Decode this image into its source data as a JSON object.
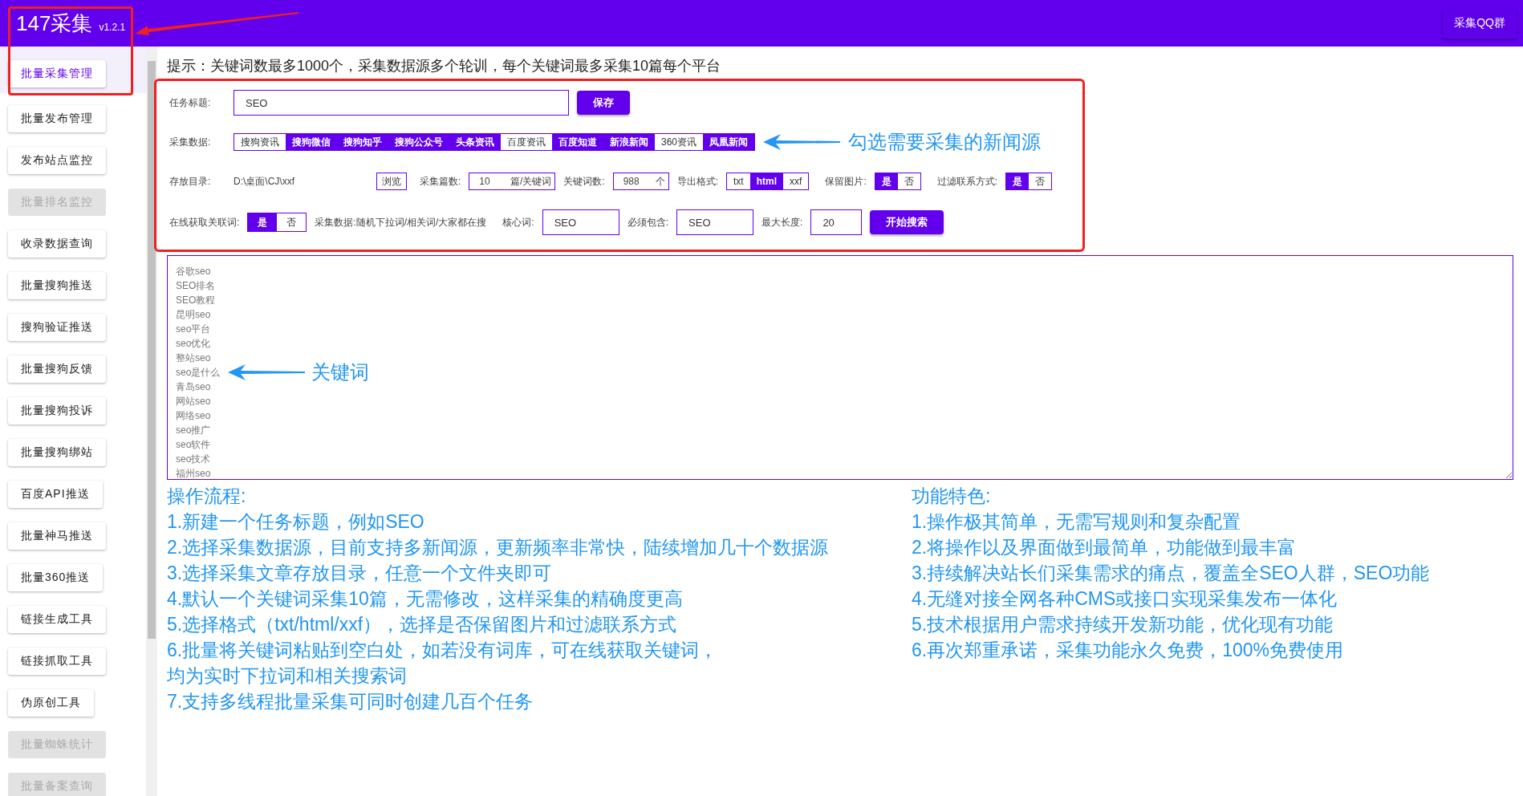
{
  "header": {
    "title": "147采集",
    "version": "v1.2.1",
    "qq_button": "采集QQ群"
  },
  "sidebar": {
    "items": [
      {
        "label": "批量采集管理",
        "selected": true,
        "disabled": false
      },
      {
        "label": "批量发布管理",
        "selected": false,
        "disabled": false
      },
      {
        "label": "发布站点监控",
        "selected": false,
        "disabled": false
      },
      {
        "label": "批量排名监控",
        "selected": false,
        "disabled": true
      },
      {
        "label": "收录数据查询",
        "selected": false,
        "disabled": false
      },
      {
        "label": "批量搜狗推送",
        "selected": false,
        "disabled": false
      },
      {
        "label": "搜狗验证推送",
        "selected": false,
        "disabled": false
      },
      {
        "label": "批量搜狗反馈",
        "selected": false,
        "disabled": false
      },
      {
        "label": "批量搜狗投诉",
        "selected": false,
        "disabled": false
      },
      {
        "label": "批量搜狗绑站",
        "selected": false,
        "disabled": false
      },
      {
        "label": "百度API推送",
        "selected": false,
        "disabled": false
      },
      {
        "label": "批量神马推送",
        "selected": false,
        "disabled": false
      },
      {
        "label": "批量360推送",
        "selected": false,
        "disabled": false
      },
      {
        "label": "链接生成工具",
        "selected": false,
        "disabled": false
      },
      {
        "label": "链接抓取工具",
        "selected": false,
        "disabled": false
      },
      {
        "label": "伪原创工具",
        "selected": false,
        "disabled": false
      },
      {
        "label": "批量蜘蛛统计",
        "selected": false,
        "disabled": true
      },
      {
        "label": "批量备案查询",
        "selected": false,
        "disabled": true
      }
    ]
  },
  "hint": "提示：关键词数最多1000个，采集数据源多个轮训，每个关键词最多采集10篇每个平台",
  "form": {
    "task_title": {
      "label": "任务标题:",
      "value": "SEO"
    },
    "save_button": "保存",
    "sources": {
      "label": "采集数据:",
      "items": [
        {
          "label": "搜狗资讯",
          "selected": false
        },
        {
          "label": "搜狗微信",
          "selected": true
        },
        {
          "label": "搜狗知乎",
          "selected": true
        },
        {
          "label": "搜狗公众号",
          "selected": true
        },
        {
          "label": "头条资讯",
          "selected": true
        },
        {
          "label": "百度资讯",
          "selected": false
        },
        {
          "label": "百度知道",
          "selected": true
        },
        {
          "label": "新浪新闻",
          "selected": true
        },
        {
          "label": "360资讯",
          "selected": false
        },
        {
          "label": "凤凰新闻",
          "selected": true
        }
      ]
    },
    "directory": {
      "label": "存放目录:",
      "value": "D:\\桌面\\CJ\\xxf"
    },
    "browse_button": "浏览",
    "article_count": {
      "label": "采集篇数:",
      "value": "10",
      "unit": "篇/关键词"
    },
    "keyword_count": {
      "label": "关键词数:",
      "value": "988",
      "unit": "个"
    },
    "export_format": {
      "label": "导出格式:",
      "options": [
        {
          "label": "txt",
          "selected": false
        },
        {
          "label": "html",
          "selected": true
        },
        {
          "label": "xxf",
          "selected": false
        }
      ]
    },
    "keep_images": {
      "label": "保留图片:",
      "options": [
        {
          "label": "是",
          "selected": true
        },
        {
          "label": "否",
          "selected": false
        }
      ]
    },
    "filter_contacts": {
      "label": "过滤联系方式:",
      "options": [
        {
          "label": "是",
          "selected": true
        },
        {
          "label": "否",
          "selected": false
        }
      ]
    },
    "online_related": {
      "label": "在线获取关联词:",
      "options": [
        {
          "label": "是",
          "selected": true
        },
        {
          "label": "否",
          "selected": false
        }
      ]
    },
    "source_note": "采集数据:随机下拉词/相关词/大家都在搜",
    "core_word": {
      "label": "核心词:",
      "value": "SEO"
    },
    "must_contain": {
      "label": "必须包含:",
      "value": "SEO"
    },
    "max_length": {
      "label": "最大长度:",
      "value": "20"
    },
    "search_button": "开始搜索"
  },
  "keywords": [
    "谷歌seo",
    "SEO排名",
    "SEO教程",
    "昆明seo",
    "seo平台",
    "seo优化",
    "整站seo",
    "seo是什么",
    "青岛seo",
    "网站seo",
    "网络seo",
    "seo推广",
    "seo软件",
    "seo技术",
    "福州seo"
  ],
  "workflow": {
    "title": "操作流程:",
    "lines": [
      "1.新建一个任务标题，例如SEO",
      "2.选择采集数据源，目前支持多新闻源，更新频率非常快，陆续增加几十个数据源",
      "3.选择采集文章存放目录，任意一个文件夹即可",
      "4.默认一个关键词采集10篇，无需修改，这样采集的精确度更高",
      "5.选择格式（txt/html/xxf），选择是否保留图片和过滤联系方式",
      "6.批量将关键词粘贴到空白处，如若没有词库，可在线获取关键词，",
      "均为实时下拉词和相关搜索词",
      "7.支持多线程批量采集可同时创建几百个任务"
    ]
  },
  "features": {
    "title": "功能特色:",
    "lines": [
      "1.操作极其简单，无需写规则和复杂配置",
      "2.将操作以及界面做到最简单，功能做到最丰富",
      "3.持续解决站长们采集需求的痛点，覆盖全SEO人群，SEO功能",
      "4.无缝对接全网各种CMS或接口实现采集发布一体化",
      "5.技术根据用户需求持续开发新功能，优化现有功能",
      "6.再次郑重承诺，采集功能永久免费，100%免费使用"
    ]
  },
  "annotations": {
    "logo_box": true,
    "logo_arrow": true,
    "form_box": true,
    "sources_note": "勾选需要采集的新闻源",
    "keywords_note": "关键词"
  }
}
